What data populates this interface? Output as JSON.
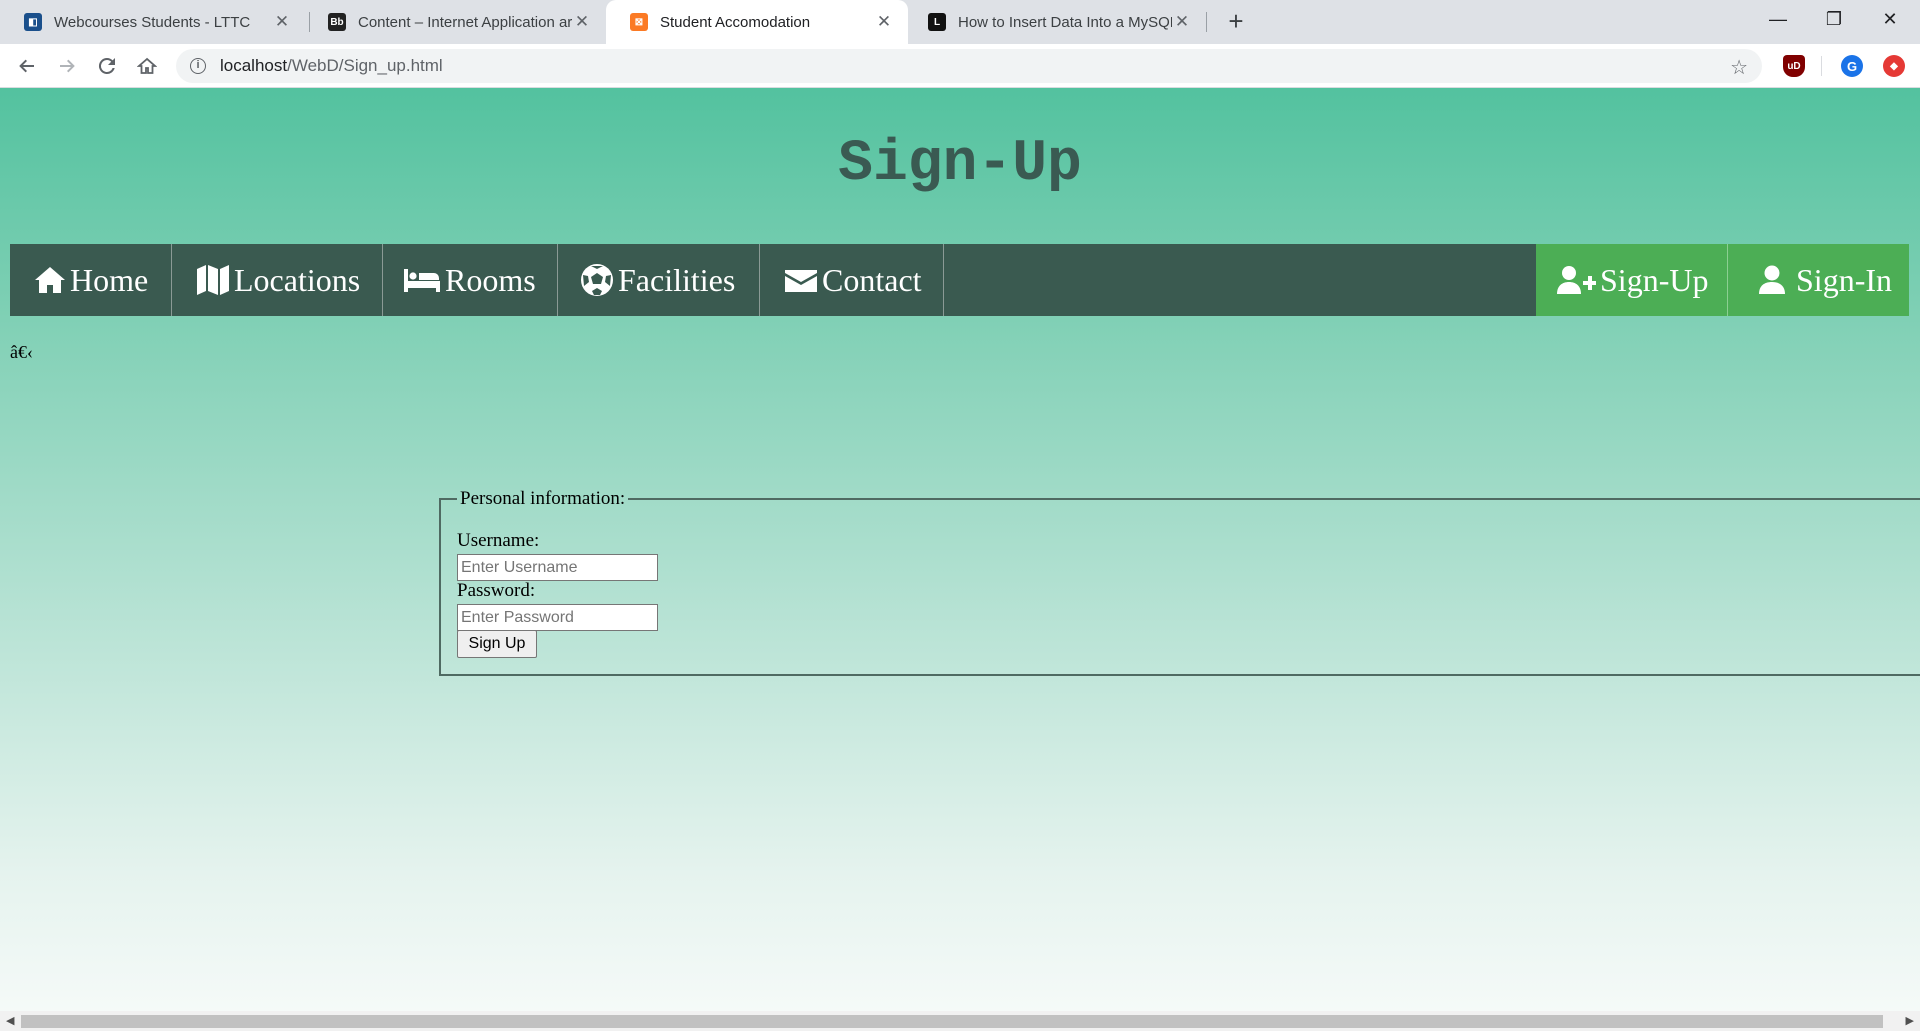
{
  "browser": {
    "tabs": [
      {
        "title": "Webcourses Students - LTTC",
        "favicon": "webcourses-favicon-icon",
        "color": "#1a4f8b"
      },
      {
        "title": "Content – Internet Application ar",
        "favicon": "blackboard-favicon-icon",
        "color": "#222222"
      },
      {
        "title": "Student Accomodation",
        "favicon": "xampp-favicon-icon",
        "color": "#fb7a24"
      },
      {
        "title": "How to Insert Data Into a MySQL",
        "favicon": "l-favicon-icon",
        "color": "#111111"
      }
    ],
    "close_glyph": "✕",
    "new_tab_glyph": "+",
    "window_controls": {
      "minimize": "—",
      "restore": "❐",
      "close": "✕"
    },
    "address": {
      "host": "localhost",
      "path": "/WebD/Sign_up.html"
    },
    "extensions": [
      {
        "name": "ublock-icon",
        "label": "uD",
        "color": "#800000"
      },
      {
        "name": "profile-avatar-icon",
        "label": "G",
        "color": "#1a73e8"
      },
      {
        "name": "extension-red-icon",
        "label": "◆",
        "color": "#e53935"
      }
    ]
  },
  "page": {
    "title": "Sign-Up",
    "nav_left": [
      {
        "label": "Home",
        "icon": "home-icon"
      },
      {
        "label": "Locations",
        "icon": "map-icon"
      },
      {
        "label": "Rooms",
        "icon": "bed-icon"
      },
      {
        "label": "Facilities",
        "icon": "soccer-ball-icon"
      },
      {
        "label": "Contact",
        "icon": "envelope-icon"
      }
    ],
    "nav_right": [
      {
        "label": "Sign-Up",
        "icon": "user-plus-icon"
      },
      {
        "label": "Sign-In",
        "icon": "user-icon"
      }
    ],
    "stray_text": "â€‹",
    "form": {
      "legend": "Personal information:",
      "username_label": "Username:",
      "username_placeholder": "Enter Username",
      "password_label": "Password:",
      "password_placeholder": "Enter Password",
      "submit_label": "Sign Up"
    }
  },
  "colors": {
    "nav_bg": "#3a5a50",
    "nav_active": "#4cae55",
    "page_gradient_top": "#53c29f",
    "page_gradient_bottom": "#f5faf8"
  }
}
